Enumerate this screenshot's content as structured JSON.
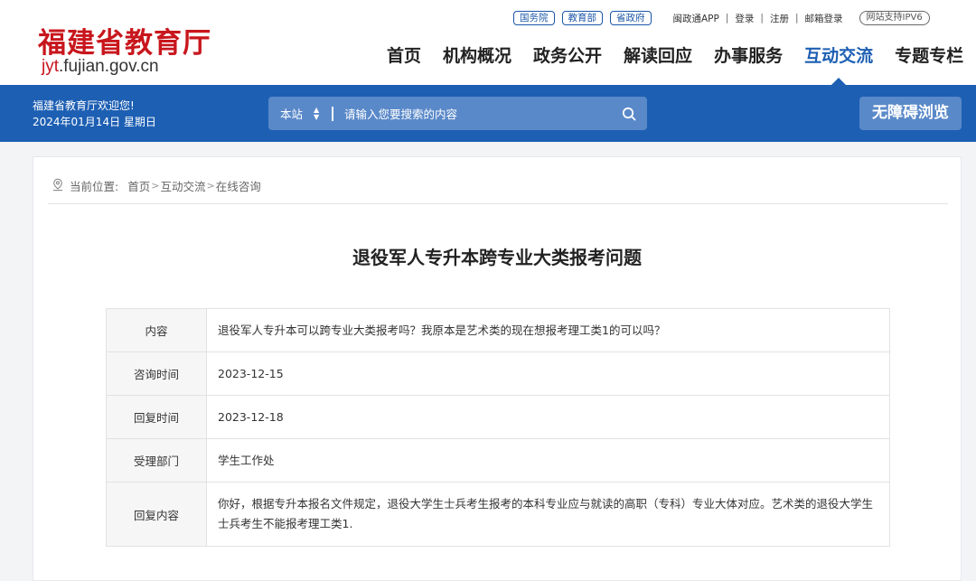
{
  "header": {
    "logo_title": "福建省教育厅",
    "logo_url_prefix": "jyt",
    "logo_url_suffix": ".fujian.gov.cn",
    "top_pills": [
      "国务院",
      "教育部",
      "省政府"
    ],
    "top_links": [
      "闽政通APP",
      "登录",
      "注册",
      "邮箱登录"
    ],
    "ipv6": "网站支持IPV6",
    "nav": [
      "首页",
      "机构概况",
      "政务公开",
      "解读回应",
      "办事服务",
      "互动交流",
      "专题专栏"
    ]
  },
  "bar": {
    "welcome": "福建省教育厅欢迎您!",
    "date": "2024年01月14日 星期日",
    "search_scope": "本站",
    "search_placeholder": "请输入您要搜索的内容",
    "accessibility": "无障碍浏览"
  },
  "breadcrumb": {
    "label": "当前位置:",
    "items": [
      "首页",
      "互动交流",
      "在线咨询"
    ]
  },
  "article": {
    "title": "退役军人专升本跨专业大类报考问题",
    "rows": [
      {
        "label": "内容",
        "value": "退役军人专升本可以跨专业大类报考吗？我原本是艺术类的现在想报考理工类1的可以吗？"
      },
      {
        "label": "咨询时间",
        "value": "2023-12-15"
      },
      {
        "label": "回复时间",
        "value": "2023-12-18"
      },
      {
        "label": "受理部门",
        "value": "学生工作处"
      },
      {
        "label": "回复内容",
        "value": "你好，根据专升本报名文件规定，退役大学生士兵考生报考的本科专业应与就读的高职（专科）专业大体对应。艺术类的退役大学生士兵考生不能报考理工类1."
      }
    ]
  },
  "colors": {
    "brand_red": "#c8161d",
    "brand_blue": "#1d5fb3"
  }
}
